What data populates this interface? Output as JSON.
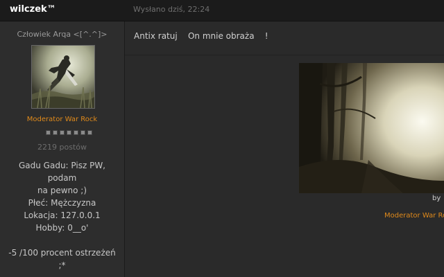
{
  "header": {
    "username": "wilczek™",
    "posted": "Wysłano dziś, 22:24"
  },
  "author": {
    "rank_title": "Człowiek Arqa <[^.^]>",
    "avatar_icon": "assassin-avatar-icon",
    "group": "Moderator War Rock",
    "rank_pips": 7,
    "post_count": "2219 postów",
    "profile_lines": [
      "Gadu Gadu: Pisz PW, podam",
      "na pewno ;)",
      "Płeć: Mężczyzna",
      "Lokacja: 127.0.0.1",
      "Hobby: 0__o'"
    ],
    "warnings_lines": [
      "-5 /100 procent ostrzeżeń",
      ";*"
    ]
  },
  "post": {
    "message": "Antix ratuj    On mnie obraża    !"
  },
  "signature": {
    "image_icon": "forest-banner-image",
    "by_text": "by",
    "group_text": "Moderator War Rock"
  },
  "colors": {
    "accent": "#e08a1b",
    "background": "#2b2b2b",
    "header": "#1b1b1b"
  }
}
